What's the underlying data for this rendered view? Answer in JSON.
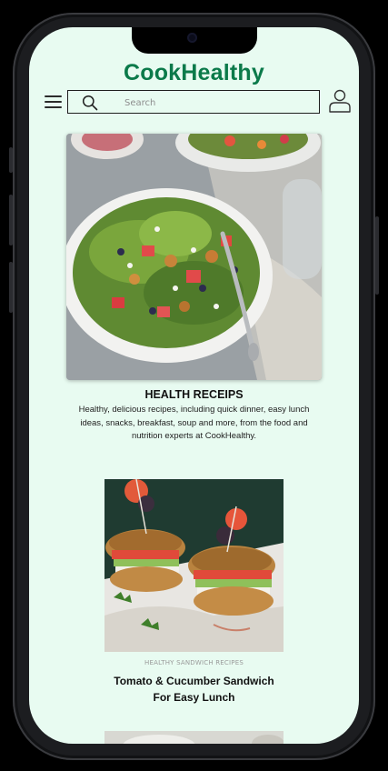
{
  "app": {
    "brand": "CookHealthy"
  },
  "search": {
    "placeholder": "Search"
  },
  "icons": {
    "menu": "hamburger-menu-icon",
    "search": "search-icon",
    "user": "user-icon"
  },
  "colors": {
    "brand": "#0b7a4a",
    "background": "#e8fbf1",
    "text": "#111111",
    "muted": "#9a9a9a"
  },
  "featured": {
    "title": "HEALTH RECEIPS",
    "description": "Healthy, delicious recipes, including quick dinner, easy lunch ideas, snacks, breakfast, soup and more, from the food and nutrition experts at CookHealthy."
  },
  "recipe_card": {
    "category": "HEALTHY SANDWICH RECIPES",
    "title_line1": "Tomato & Cucumber Sandwich",
    "title_line2": "For Easy Lunch"
  }
}
